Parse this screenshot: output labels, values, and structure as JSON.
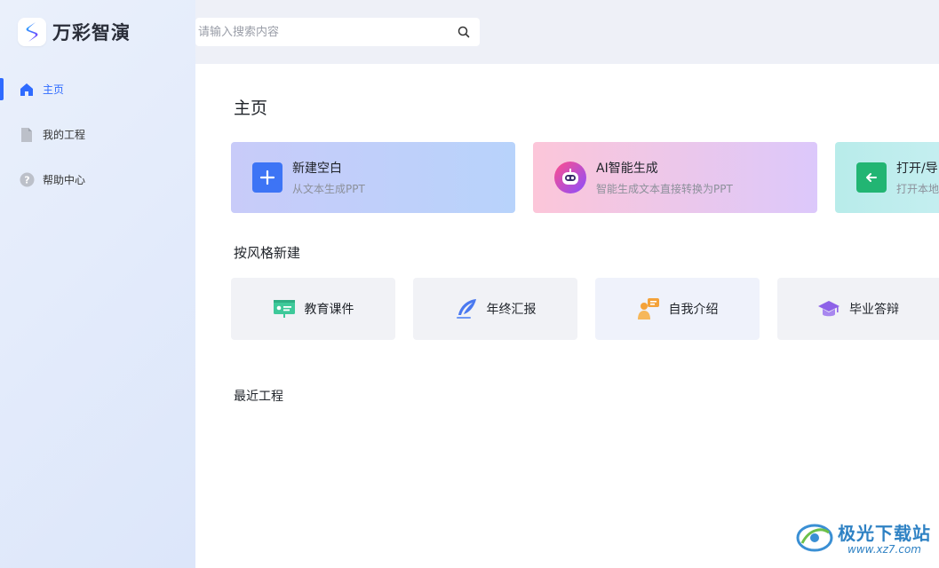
{
  "app": {
    "name": "万彩智演"
  },
  "search": {
    "placeholder": "请输入搜索内容"
  },
  "sidebar": {
    "items": [
      {
        "label": "主页",
        "icon": "home-icon",
        "active": true
      },
      {
        "label": "我的工程",
        "icon": "document-icon",
        "active": false
      },
      {
        "label": "帮助中心",
        "icon": "help-icon",
        "active": false
      }
    ]
  },
  "main": {
    "title": "主页",
    "actions": [
      {
        "title": "新建空白",
        "subtitle": "从文本生成PPT",
        "icon": "plus-icon"
      },
      {
        "title": "AI智能生成",
        "subtitle": "智能生成文本直接转换为PPT",
        "icon": "robot-icon"
      },
      {
        "title": "打开/导",
        "subtitle": "打开本地",
        "icon": "import-icon"
      }
    ],
    "style_section_title": "按风格新建",
    "styles": [
      {
        "label": "教育课件",
        "icon": "presentation-board-icon"
      },
      {
        "label": "年终汇报",
        "icon": "feather-pen-icon"
      },
      {
        "label": "自我介绍",
        "icon": "person-speech-icon"
      },
      {
        "label": "毕业答辩",
        "icon": "graduation-cap-icon"
      }
    ],
    "recent_title": "最近工程"
  },
  "watermark": {
    "text": "极光下载站",
    "url": "www.xz7.com"
  },
  "colors": {
    "accent": "#2f6bff",
    "sidebar_bg": "#e3ebfb",
    "card_blank_from": "#c8cbf9",
    "card_blank_to": "#b8d3fb",
    "card_ai_from": "#fcc6d9",
    "card_ai_to": "#dcc8fb",
    "card_import_from": "#b8ecea",
    "style_card_bg": "#f1f2f6"
  }
}
